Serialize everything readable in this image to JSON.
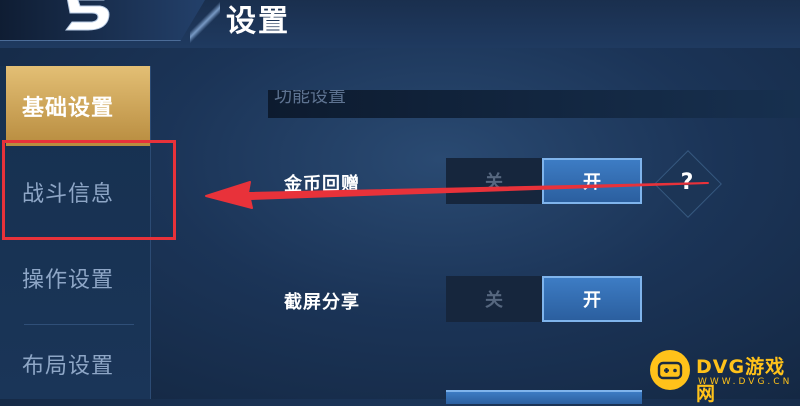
{
  "header": {
    "title": "设置"
  },
  "sidebar": {
    "items": [
      {
        "label": "基础设置",
        "active": true
      },
      {
        "label": "战斗信息",
        "active": false
      },
      {
        "label": "操作设置",
        "active": false
      },
      {
        "label": "布局设置",
        "active": false
      }
    ]
  },
  "content": {
    "section_title": "功能设置",
    "rows": [
      {
        "label": "金币回赠",
        "off_label": "关",
        "on_label": "开",
        "state": "开",
        "help": "?"
      },
      {
        "label": "截屏分享",
        "off_label": "关",
        "on_label": "开",
        "state": "开"
      }
    ]
  },
  "annotation": {
    "color": "#e8323a"
  },
  "watermark": {
    "title": "DVG游戏网",
    "url": "WWW.DVG.CN"
  },
  "colors": {
    "active_tab": "#d4ad5e",
    "toggle_on": "#3a74b8",
    "accent": "#ffc21a"
  }
}
